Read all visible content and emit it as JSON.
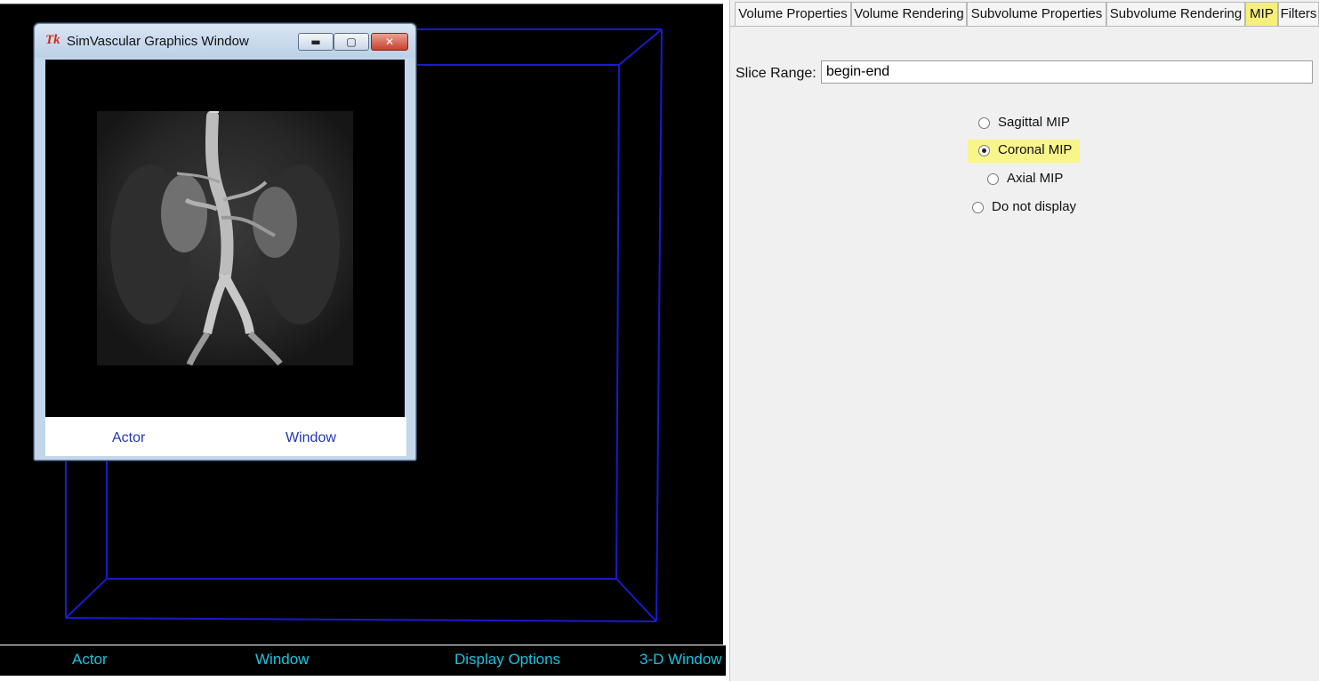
{
  "viewport": {
    "bottom_bar": {
      "actor": "Actor",
      "window": "Window",
      "display_options": "Display Options",
      "three_d_window": "3-D Window"
    },
    "box_color": "#1a1acc"
  },
  "graphics_window": {
    "title": "SimVascular Graphics Window",
    "logo_text": "Tk",
    "footer": {
      "actor": "Actor",
      "window": "Window"
    }
  },
  "panel": {
    "tabs": [
      "Volume Properties",
      "Volume Rendering",
      "Subvolume Properties",
      "Subvolume Rendering",
      "MIP",
      "Filters"
    ],
    "active_tab": "MIP",
    "slice_range": {
      "label": "Slice Range:",
      "value": "begin-end"
    },
    "mip_options": [
      {
        "label": "Sagittal MIP",
        "selected": false
      },
      {
        "label": "Coronal MIP",
        "selected": true
      },
      {
        "label": "Axial MIP",
        "selected": false
      },
      {
        "label": "Do not display",
        "selected": false
      }
    ],
    "highlight_color": "#f6f07a"
  }
}
